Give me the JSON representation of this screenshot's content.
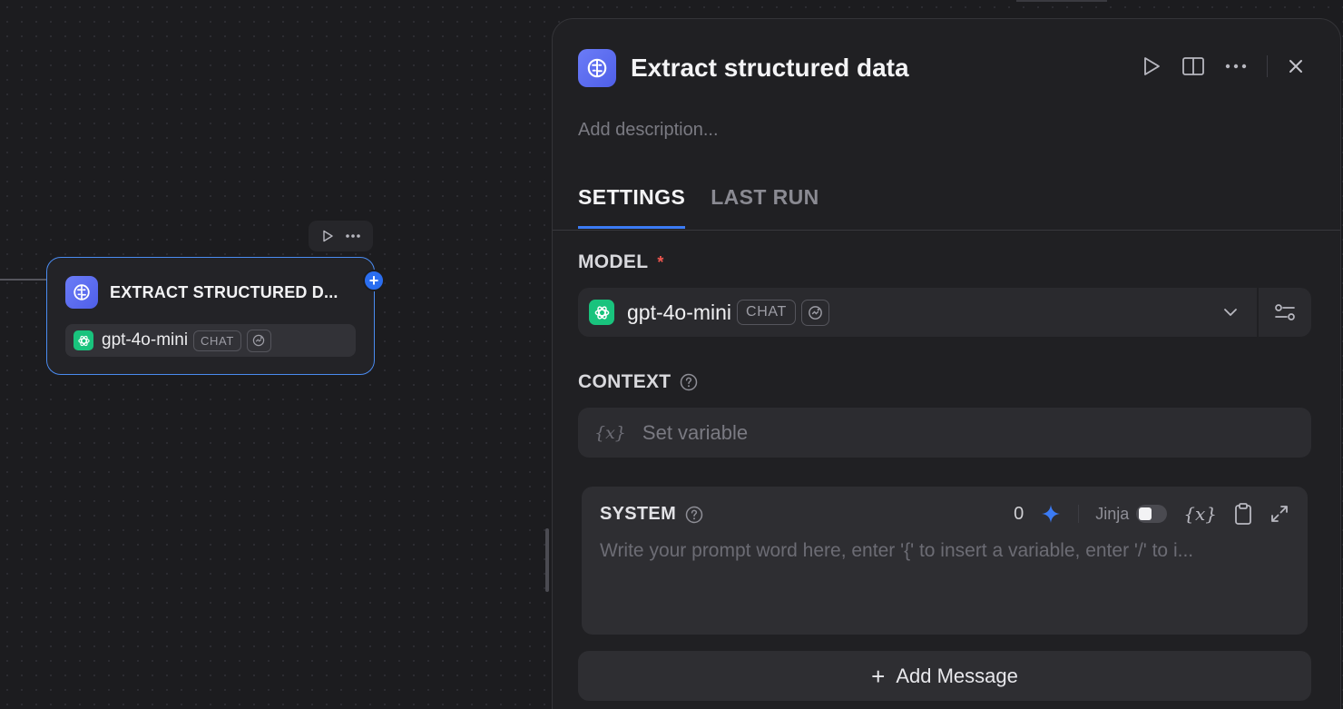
{
  "node": {
    "title": "EXTRACT STRUCTURED D...",
    "model": "gpt-4o-mini",
    "chip": "CHAT",
    "add_symbol": "+",
    "border_color": "#4a8bf0"
  },
  "panel": {
    "title": "Extract structured data",
    "description_placeholder": "Add description...",
    "tabs": [
      {
        "label": "SETTINGS",
        "active": true
      },
      {
        "label": "LAST RUN",
        "active": false
      }
    ],
    "model_section": {
      "label": "MODEL",
      "required_mark": "*",
      "model": "gpt-4o-mini",
      "chip": "CHAT"
    },
    "context_section": {
      "label": "CONTEXT",
      "var_glyph": "{x}",
      "placeholder": "Set variable"
    },
    "system_section": {
      "label": "SYSTEM",
      "count": "0",
      "jinja_label": "Jinja",
      "var_glyph": "{x}",
      "placeholder": "Write your prompt word here, enter '{' to insert a variable, enter '/' to i..."
    },
    "add_message": {
      "plus": "+",
      "label": "Add Message"
    }
  },
  "colors": {
    "accent": "#3b7bf5",
    "app_icon": "#5b6cf2",
    "openai_green": "#19c37d",
    "required": "#f0564f",
    "sparkle": "#3b7bf5"
  },
  "icons": [
    "play-icon",
    "more-icon",
    "brain-icon",
    "openai-icon",
    "vision-icon",
    "book-icon",
    "close-icon",
    "chevron-down-icon",
    "params-icon",
    "help-icon",
    "sparkle-icon",
    "clipboard-icon",
    "expand-icon"
  ]
}
